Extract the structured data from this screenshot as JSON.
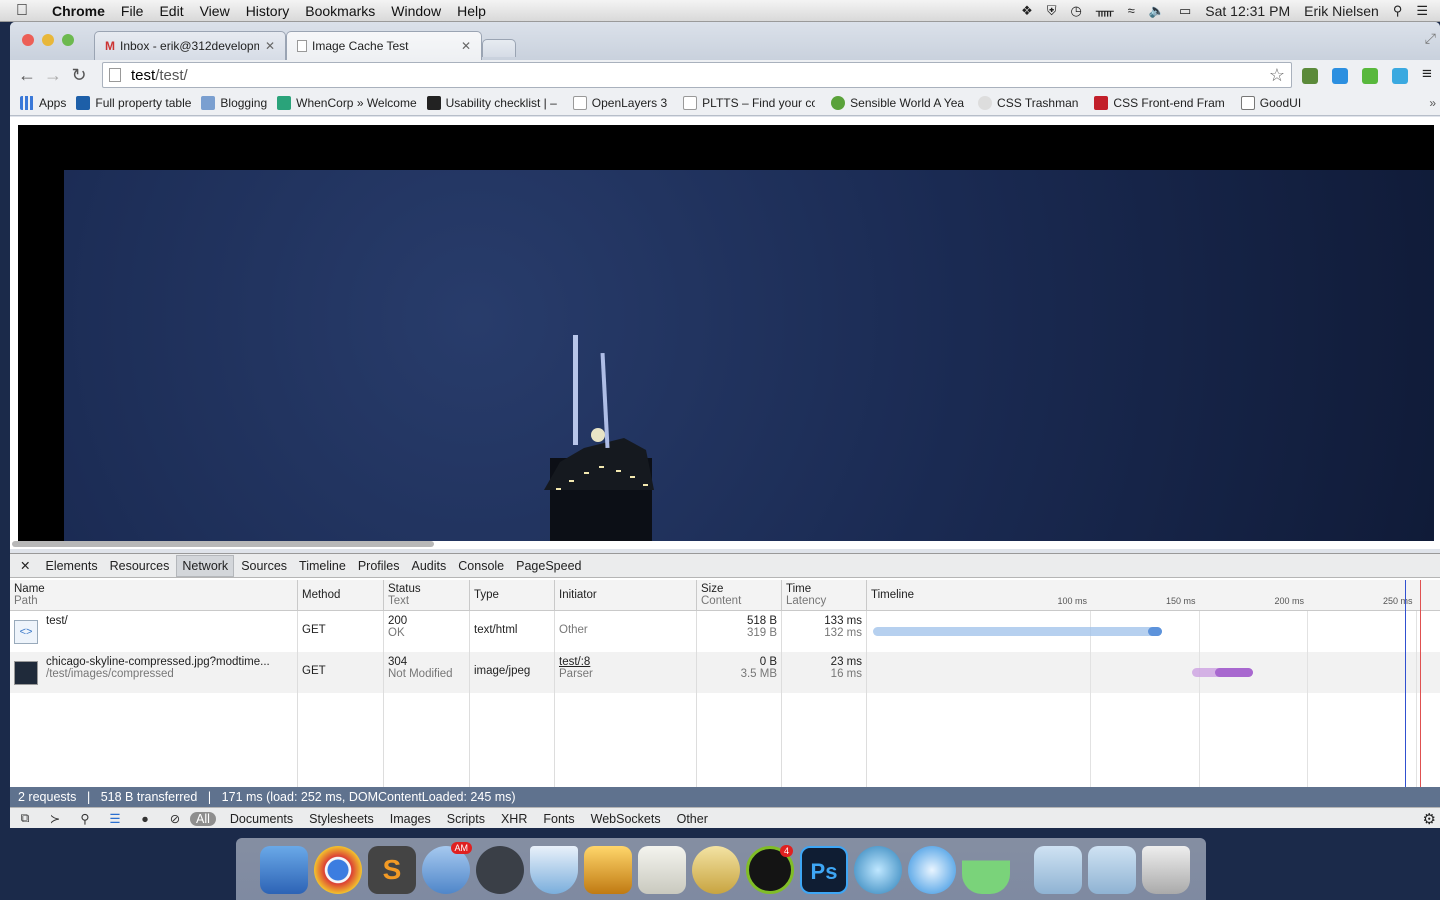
{
  "menubar": {
    "app": "Chrome",
    "items": [
      "File",
      "Edit",
      "View",
      "History",
      "Bookmarks",
      "Window",
      "Help"
    ],
    "clock": "Sat 12:31 PM",
    "user": "Erik Nielsen"
  },
  "tabs": [
    {
      "label": "Inbox - erik@312developm"
    },
    {
      "label": "Image Cache Test"
    }
  ],
  "omnibox": {
    "url_prefix": "test",
    "url_rest": "/test/"
  },
  "bookmarks": [
    "Apps",
    "Full property table",
    "Blogging",
    "WhenCorp » Welcome",
    "Usability checklist | –",
    "OpenLayers 3",
    "PLTTS – Find your co",
    "Sensible World A Yea",
    "CSS Trashman",
    "CSS Front-end Fram",
    "GoodUI"
  ],
  "devtools": {
    "tabs": [
      "Elements",
      "Resources",
      "Network",
      "Sources",
      "Timeline",
      "Profiles",
      "Audits",
      "Console",
      "PageSpeed"
    ],
    "columns": {
      "name": "Name",
      "path": "Path",
      "method": "Method",
      "status": "Status",
      "text": "Text",
      "type": "Type",
      "initiator": "Initiator",
      "size": "Size",
      "content": "Content",
      "time": "Time",
      "latency": "Latency",
      "timeline": "Timeline"
    },
    "ticks": [
      "100 ms",
      "150 ms",
      "200 ms",
      "250 ms"
    ],
    "requests": [
      {
        "name": "test/",
        "path": "",
        "method": "GET",
        "status": "200",
        "status_text": "OK",
        "type": "text/html",
        "initiator": "Other",
        "initiator_sub": "",
        "size": "518 B",
        "content": "319 B",
        "time": "133 ms",
        "latency": "132 ms",
        "tl_start_ms": 0,
        "tl_end_ms": 133,
        "tl_latency_ms": 132
      },
      {
        "name": "chicago-skyline-compressed.jpg?modtime...",
        "path": "/test/images/compressed",
        "method": "GET",
        "status": "304",
        "status_text": "Not Modified",
        "type": "image/jpeg",
        "initiator": "test/:8",
        "initiator_sub": "Parser",
        "size": "0 B",
        "content": "3.5 MB",
        "time": "23 ms",
        "latency": "16 ms",
        "tl_start_ms": 147,
        "tl_end_ms": 175,
        "tl_latency_ms": 16
      }
    ],
    "summary": "2 requests  ❘  518 B transferred  ❘  171 ms (load: 252 ms, DOMContentLoaded: 245 ms)",
    "filters": [
      "All",
      "Documents",
      "Stylesheets",
      "Images",
      "Scripts",
      "XHR",
      "Fonts",
      "WebSockets",
      "Other"
    ]
  },
  "dock": {
    "badges": {
      "sparrow": "AM",
      "spotify": "4"
    },
    "ps_label": "Ps"
  },
  "colors": {
    "status_bar": "#5f728e",
    "tl_html": "#9ec0ea",
    "tl_image": "#c99be0",
    "load_line": "#e05050",
    "dcl_line": "#3050d0"
  }
}
